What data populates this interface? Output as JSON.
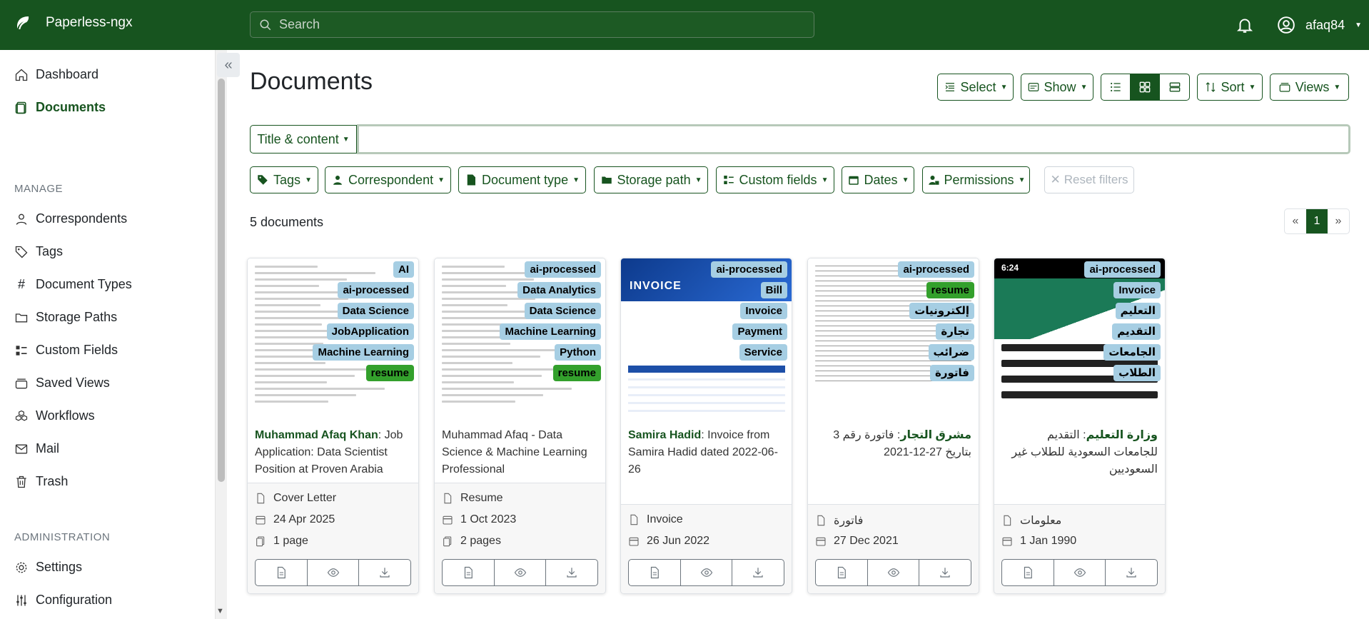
{
  "app": {
    "name": "Paperless-ngx",
    "search_placeholder": "Search",
    "user": "afaq84"
  },
  "sidebar": {
    "items": [
      {
        "label": "Dashboard"
      },
      {
        "label": "Documents"
      }
    ],
    "manage_heading": "MANAGE",
    "manage": [
      {
        "label": "Correspondents"
      },
      {
        "label": "Tags"
      },
      {
        "label": "Document Types"
      },
      {
        "label": "Storage Paths"
      },
      {
        "label": "Custom Fields"
      },
      {
        "label": "Saved Views"
      },
      {
        "label": "Workflows"
      },
      {
        "label": "Mail"
      },
      {
        "label": "Trash"
      }
    ],
    "admin_heading": "ADMINISTRATION",
    "admin": [
      {
        "label": "Settings"
      },
      {
        "label": "Configuration"
      }
    ]
  },
  "page": {
    "title": "Documents",
    "toolbar": {
      "select": "Select",
      "show": "Show",
      "sort": "Sort",
      "views": "Views"
    },
    "search_scope": "Title & content",
    "filters": {
      "tags": "Tags",
      "correspondent": "Correspondent",
      "document_type": "Document type",
      "storage_path": "Storage path",
      "custom_fields": "Custom fields",
      "dates": "Dates",
      "permissions": "Permissions",
      "reset": "Reset filters"
    },
    "count": "5 documents",
    "pager": {
      "prev": "«",
      "current": "1",
      "next": "»"
    }
  },
  "documents": [
    {
      "correspondent": "Muhammad Afaq Khan",
      "title": ": Job Application: Data Scientist Position at Proven Arabia",
      "tags": [
        "AI",
        "ai-processed",
        "Data Science",
        "JobApplication",
        "Machine Learning",
        "resume"
      ],
      "type": "Cover Letter",
      "date": "24 Apr 2025",
      "pages": "1 page"
    },
    {
      "correspondent": "",
      "title": "Muhammad Afaq - Data Science & Machine Learning Professional",
      "tags": [
        "ai-processed",
        "Data Analytics",
        "Data Science",
        "Machine Learning",
        "Python",
        "resume"
      ],
      "type": "Resume",
      "date": "1 Oct 2023",
      "pages": "2 pages"
    },
    {
      "correspondent": "Samira Hadid",
      "title": ": Invoice from Samira Hadid dated 2022-06-26",
      "tags": [
        "ai-processed",
        "Bill",
        "Invoice",
        "Payment",
        "Service"
      ],
      "type": "Invoice",
      "date": "26 Jun 2022",
      "pages": "",
      "thumb_text": "INVOICE"
    },
    {
      "correspondent": "مشرق التجار",
      "title": ": فاتورة رقم 3 بتاريخ 27-12-2021",
      "tags": [
        "ai-processed",
        "resume",
        "إلكترونيات",
        "تجارة",
        "ضرائب",
        "فاتورة"
      ],
      "type": "فاتورة",
      "date": "27 Dec 2021",
      "pages": ""
    },
    {
      "correspondent": "وزارة التعليم",
      "title": ": التقديم للجامعات السعودية للطلاب غير السعوديين",
      "tags": [
        "ai-processed",
        "Invoice",
        "التعليم",
        "التقديم",
        "الجامعات",
        "الطلاب"
      ],
      "type": "معلومات",
      "date": "1 Jan 1990",
      "pages": "",
      "thumb_time": "6:24"
    }
  ],
  "colors": {
    "brand": "#17541f",
    "tag_blue": "#a6cee3",
    "tag_green": "#33a02c"
  }
}
